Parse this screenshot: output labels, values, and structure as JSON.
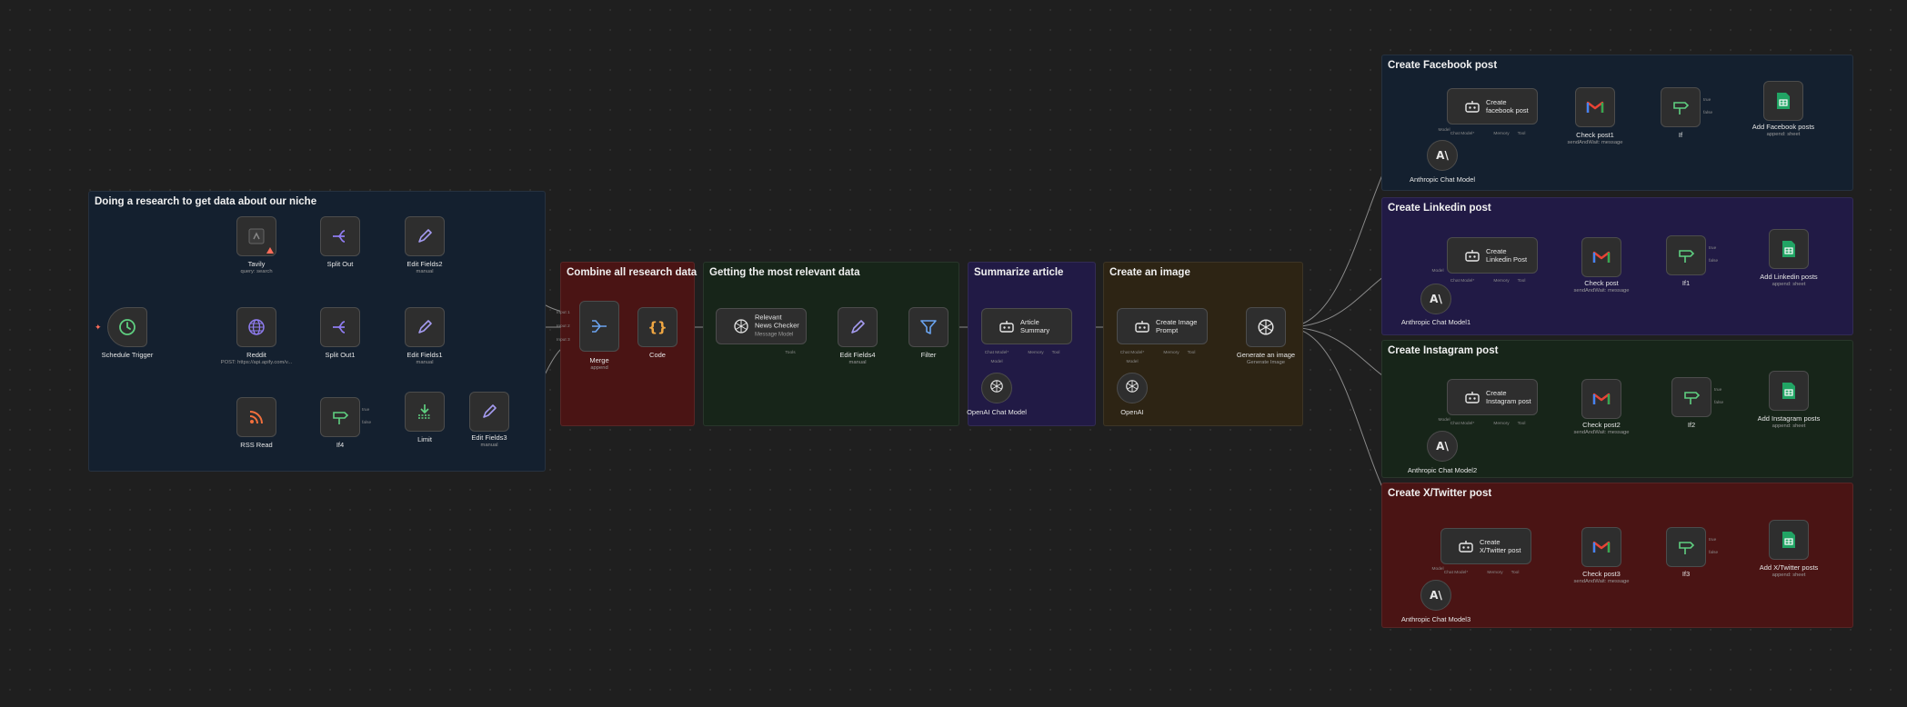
{
  "sections": {
    "research": "Doing a research to get data about our niche",
    "combine": "Combine all research data",
    "relevant": "Getting the most relevant data",
    "summarize": "Summarize article",
    "image": "Create an image",
    "facebook": "Create Facebook post",
    "linkedin": "Create Linkedin post",
    "instagram": "Create Instagram post",
    "twitter": "Create X/Twitter post"
  },
  "nodes": {
    "schedule": {
      "label": "Schedule Trigger"
    },
    "tavily": {
      "label": "Tavily",
      "sub": "query: search"
    },
    "reddit": {
      "label": "Reddit",
      "sub": "POST: https://api.apify.com/v..."
    },
    "rss": {
      "label": "RSS Read"
    },
    "split_out": {
      "label": "Split Out"
    },
    "split_out1": {
      "label": "Split Out1"
    },
    "if4": {
      "label": "If4",
      "true": "true",
      "false": "false"
    },
    "limit": {
      "label": "Limit"
    },
    "edit2": {
      "label": "Edit Fields2",
      "sub": "manual"
    },
    "edit1": {
      "label": "Edit Fields1",
      "sub": "manual"
    },
    "edit3": {
      "label": "Edit Fields3",
      "sub": "manual"
    },
    "merge": {
      "label": "Merge",
      "sub": "append",
      "in1": "Input 1",
      "in2": "Input 2",
      "in3": "Input 3"
    },
    "code": {
      "label": "Code"
    },
    "news_checker": {
      "title": "Relevant News Checker",
      "sub": "Message Model",
      "tools": "Tools"
    },
    "edit4": {
      "label": "Edit Fields4",
      "sub": "manual"
    },
    "filter": {
      "label": "Filter"
    },
    "article_summary": {
      "title": "Article Summary",
      "chat": "Chat Model*",
      "memory": "Memory",
      "tool": "Tool"
    },
    "openai_chat": {
      "label": "OpenAI Chat Model",
      "model": "Model"
    },
    "image_prompt": {
      "title": "Create Image Prompt",
      "chat": "Chat Model*",
      "memory": "Memory",
      "tool": "Tool"
    },
    "openai": {
      "label": "OpenAI",
      "model": "Model"
    },
    "generate_image": {
      "label": "Generate an image",
      "sub": "Generate Image"
    },
    "fb_post": {
      "title": "Create facebook post",
      "chat": "Chat Model*",
      "memory": "Memory",
      "tool": "Tool",
      "model": "Model"
    },
    "fb_check": {
      "label": "Check post1",
      "sub": "sendAndWait: message"
    },
    "fb_if": {
      "label": "If",
      "true": "true",
      "false": "false"
    },
    "fb_add": {
      "label": "Add Facebook posts",
      "sub": "append: sheet"
    },
    "fb_anthropic": {
      "label": "Anthropic Chat Model"
    },
    "li_post": {
      "title": "Create Linkedin Post",
      "chat": "Chat Model*",
      "memory": "Memory",
      "tool": "Tool",
      "model": "Model"
    },
    "li_check": {
      "label": "Check post",
      "sub": "sendAndWait: message"
    },
    "li_if": {
      "label": "If1",
      "true": "true",
      "false": "false"
    },
    "li_add": {
      "label": "Add Linkedin posts",
      "sub": "append: sheet"
    },
    "li_anthropic": {
      "label": "Anthropic Chat Model1"
    },
    "ig_post": {
      "title": "Create Instagram post",
      "chat": "Chat Model*",
      "memory": "Memory",
      "tool": "Tool",
      "model": "Model"
    },
    "ig_check": {
      "label": "Check post2",
      "sub": "sendAndWait: message"
    },
    "ig_if": {
      "label": "If2",
      "true": "true",
      "false": "false"
    },
    "ig_add": {
      "label": "Add Instagram posts",
      "sub": "append: sheet"
    },
    "ig_anthropic": {
      "label": "Anthropic Chat Model2"
    },
    "tw_post": {
      "title": "Create X/Twitter post",
      "chat": "Chat Model*",
      "memory": "Memory",
      "tool": "Tool",
      "model": "Model"
    },
    "tw_check": {
      "label": "Check post3",
      "sub": "sendAndWait: message"
    },
    "tw_if": {
      "label": "If3",
      "true": "true",
      "false": "false"
    },
    "tw_add": {
      "label": "Add X/Twitter posts",
      "sub": "append: sheet"
    },
    "tw_anthropic": {
      "label": "Anthropic Chat Model3"
    }
  },
  "colors": {
    "trigger": "#5fcf80",
    "split": "#8f7cf0",
    "edit": "#a59bf0",
    "code": "#f0a742",
    "filter": "#6ba4f0",
    "rss": "#f26f3c",
    "gmail": "#ea4335",
    "sheets": "#21a464",
    "edge": "#8a8a8a"
  }
}
